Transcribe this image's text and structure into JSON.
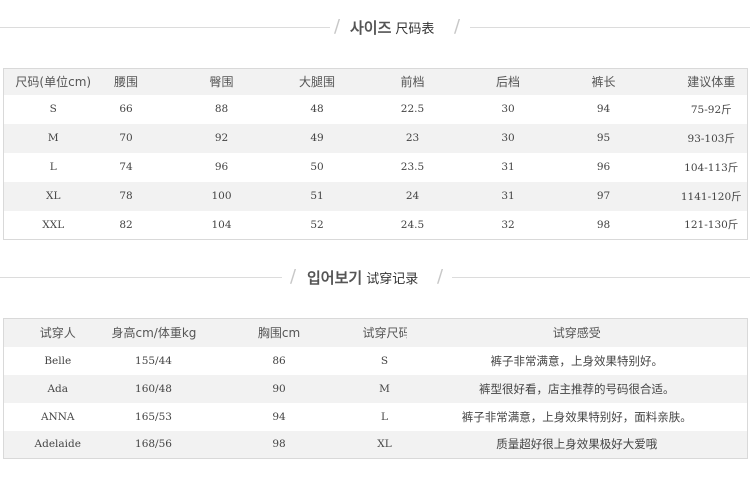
{
  "size_section": {
    "ko": "사이즈",
    "zh": "尺码表"
  },
  "size_table": {
    "headers": [
      "尺码(单位cm)",
      "腰围",
      "臀围",
      "大腿围",
      "前档",
      "后档",
      "裤长",
      "建议体重"
    ],
    "rows": [
      [
        "S",
        "66",
        "88",
        "48",
        "22.5",
        "30",
        "94",
        "75-92斤"
      ],
      [
        "M",
        "70",
        "92",
        "49",
        "23",
        "30",
        "95",
        "93-103斤"
      ],
      [
        "L",
        "74",
        "96",
        "50",
        "23.5",
        "31",
        "96",
        "104-113斤"
      ],
      [
        "XL",
        "78",
        "100",
        "51",
        "24",
        "31",
        "97",
        "1141-120斤"
      ],
      [
        "XXL",
        "82",
        "104",
        "52",
        "24.5",
        "32",
        "98",
        "121-130斤"
      ]
    ]
  },
  "trial_section": {
    "ko": "입어보기",
    "zh": "试穿记录"
  },
  "trial_table": {
    "headers": [
      "试穿人",
      "身高cm/体重kg",
      "胸围cm",
      "试穿尺码",
      "试穿感受"
    ],
    "rows": [
      [
        "Belle",
        "155/44",
        "86",
        "S",
        "裤子非常满意，上身效果特别好。"
      ],
      [
        "Ada",
        "160/48",
        "90",
        "M",
        "裤型很好看，店主推荐的号码很合适。"
      ],
      [
        "ANNA",
        "165/53",
        "94",
        "L",
        "裤子非常满意，上身效果特别好，面料亲肤。"
      ],
      [
        "Adelaide",
        "168/56",
        "98",
        "XL",
        "质量超好很上身效果极好大爱哦"
      ]
    ]
  }
}
